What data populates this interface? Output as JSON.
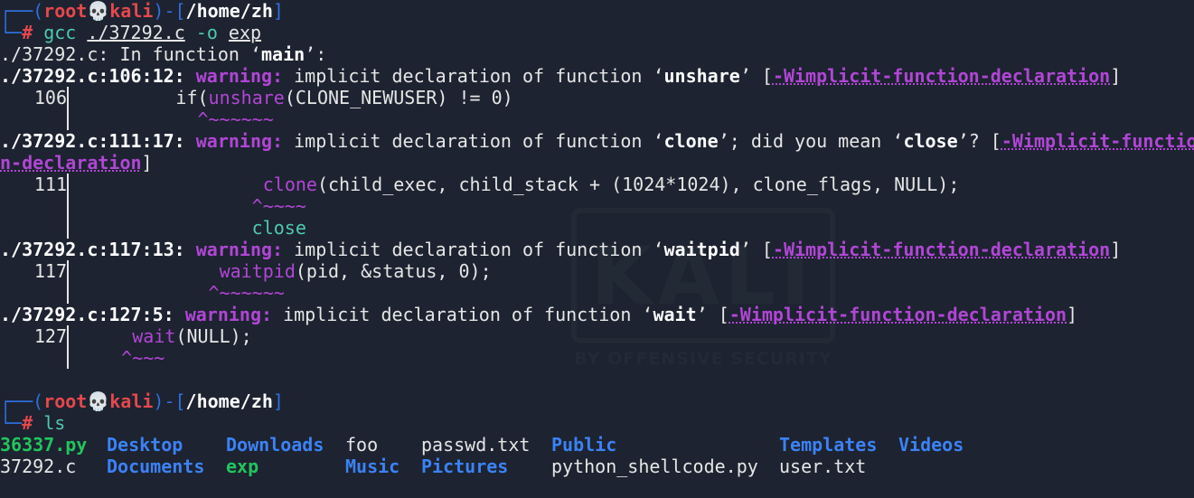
{
  "prompt": {
    "user": "root",
    "skull": "💀",
    "host": "kali",
    "cwd": "/home/zh",
    "hash": "#"
  },
  "commands": {
    "gcc": {
      "name": "gcc",
      "arg1": "./37292.c",
      "flag": "-o",
      "arg2": "exp"
    },
    "ls": {
      "name": "ls"
    }
  },
  "compile": {
    "in_function_prefix": "./37292.c: In function ‘",
    "in_function_name": "main",
    "in_function_suffix": "’:",
    "warnings": [
      {
        "loc": "./37292.c:106:12:",
        "label": "warning:",
        "msg": " implicit declaration of function ‘",
        "func": "unshare",
        "tail": "’ [",
        "flag": "-Wimplicit-function-declaration",
        "end": "]",
        "line_no": "106",
        "code_pre": "        if(",
        "code_fn": "unshare",
        "code_post": "(CLONE_NEWUSER) != 0)",
        "caret": "           ^~~~~~~"
      },
      {
        "loc": "./37292.c:111:17:",
        "label": "warning:",
        "msg": " implicit declaration of function ‘",
        "func": "clone",
        "tail1": "’; did you mean ‘",
        "suggest": "close",
        "tail2": "’? [",
        "flag_a": "-Wimplicit-functio",
        "flag_b": "n-declaration",
        "end": "]",
        "line_no": "111",
        "code_pre": "                ",
        "code_fn": "clone",
        "code_post": "(child_exec, child_stack + (1024*1024), clone_flags, NULL);",
        "caret": "                ^~~~~",
        "suggestion": "                close"
      },
      {
        "loc": "./37292.c:117:13:",
        "label": "warning:",
        "msg": " implicit declaration of function ‘",
        "func": "waitpid",
        "tail": "’ [",
        "flag": "-Wimplicit-function-declaration",
        "end": "]",
        "line_no": "117",
        "code_pre": "            ",
        "code_fn": "waitpid",
        "code_post": "(pid, &status, 0);",
        "caret": "            ^~~~~~~"
      },
      {
        "loc": "./37292.c:127:5:",
        "label": "warning:",
        "msg": " implicit declaration of function ‘",
        "func": "wait",
        "tail": "’ [",
        "flag": "-Wimplicit-function-declaration",
        "end": "]",
        "line_no": "127",
        "code_pre": "    ",
        "code_fn": "wait",
        "code_post": "(NULL);",
        "caret": "    ^~~~"
      }
    ]
  },
  "ls_output": {
    "row1": [
      {
        "name": "36337.py",
        "kind": "exe"
      },
      {
        "name": "Desktop",
        "kind": "dir"
      },
      {
        "name": "Downloads",
        "kind": "dir"
      },
      {
        "name": "foo",
        "kind": "file"
      },
      {
        "name": "passwd.txt",
        "kind": "file"
      },
      {
        "name": "Public",
        "kind": "dir"
      },
      {
        "name": "Templates",
        "kind": "dir"
      },
      {
        "name": "Videos",
        "kind": "dir"
      }
    ],
    "row2": [
      {
        "name": "37292.c",
        "kind": "file"
      },
      {
        "name": "Documents",
        "kind": "dir"
      },
      {
        "name": "exp",
        "kind": "exe"
      },
      {
        "name": "Music",
        "kind": "dir"
      },
      {
        "name": "Pictures",
        "kind": "dir"
      },
      {
        "name": "python_shellcode.py",
        "kind": "file"
      },
      {
        "name": "user.txt",
        "kind": "file"
      }
    ]
  },
  "watermark": {
    "logo_text": "KALI",
    "tagline": "BY OFFENSIVE SECURITY"
  },
  "colors": {
    "background": "#1d2330",
    "prompt_frame": "#2f6fde",
    "root_user": "#e5484d",
    "command": "#4ec9b0",
    "warning": "#b146d6",
    "directory": "#3b82f6",
    "executable": "#22c55e"
  }
}
